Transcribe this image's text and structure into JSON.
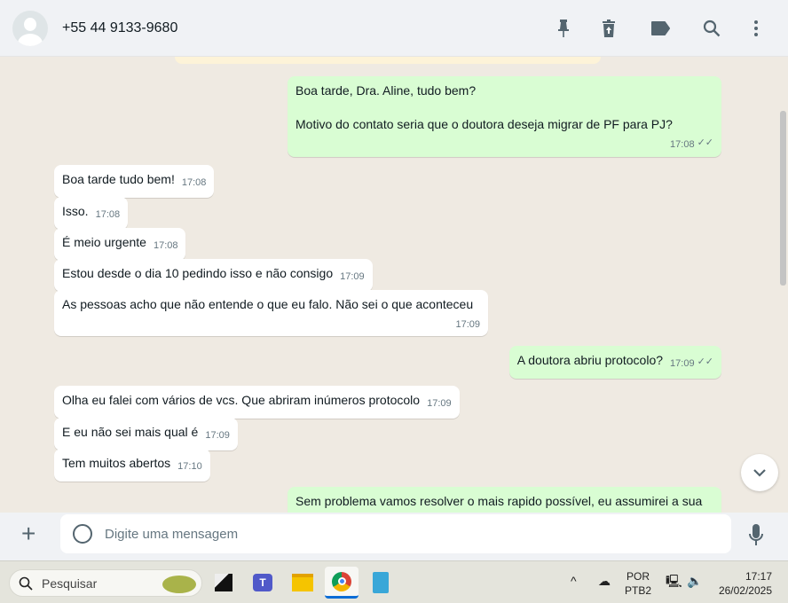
{
  "header": {
    "contact": "+55 44 9133-9680",
    "icons": [
      "pin-icon",
      "delete-icon",
      "label-icon",
      "search-icon",
      "menu-icon"
    ]
  },
  "messages": [
    {
      "dir": "out",
      "lines": [
        "Boa tarde, Dra. Aline, tudo bem?",
        "Motivo do contato seria que o doutora deseja migrar de PF para PJ?"
      ],
      "time": "17:08"
    },
    {
      "dir": "in",
      "text": "Boa tarde tudo bem!",
      "time": "17:08"
    },
    {
      "dir": "in",
      "text": "Isso.",
      "time": "17:08"
    },
    {
      "dir": "in",
      "text": "É meio urgente",
      "time": "17:08"
    },
    {
      "dir": "in",
      "text": "Estou desde o dia 10 pedindo isso e não consigo",
      "time": "17:09"
    },
    {
      "dir": "in",
      "text": "As pessoas acho que não entende o que eu falo. Não sei o que aconteceu",
      "time": "17:09"
    },
    {
      "dir": "out",
      "text": "A doutora abriu protocolo?",
      "time": "17:09"
    },
    {
      "dir": "in",
      "text": "Olha eu falei com vários de vcs. Que abriram inúmeros protocolo",
      "time": "17:09"
    },
    {
      "dir": "in",
      "text": "E eu não sei mais qual é",
      "time": "17:09"
    },
    {
      "dir": "in",
      "text": "Tem muitos abertos",
      "time": "17:10"
    },
    {
      "dir": "out",
      "text": "Sem problema vamos resolver o mais rapido possível, eu assumirei a sua"
    }
  ],
  "composer": {
    "placeholder": "Digite uma mensagem"
  },
  "taskbar": {
    "search": "Pesquisar",
    "lang1": "POR",
    "lang2": "PTB2",
    "time": "17:17",
    "date": "26/02/2025"
  }
}
